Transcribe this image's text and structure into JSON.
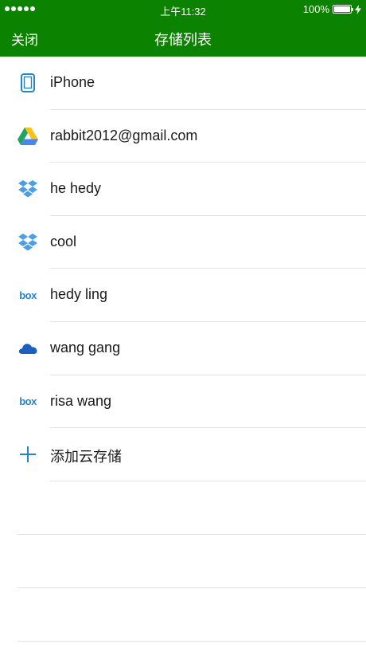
{
  "status_bar": {
    "time": "上午11:32",
    "battery_percent_label": "100%",
    "battery_level": 1.0,
    "signal_dots": 5
  },
  "nav": {
    "close_label": "关闭",
    "title": "存储列表"
  },
  "colors": {
    "header_bg": "#0b8300",
    "accent_blue": "#2486c9",
    "divider": "#e3e3e3"
  },
  "storage_list": [
    {
      "label": "iPhone",
      "icon": "iphone-device-icon"
    },
    {
      "label": "rabbit2012@gmail.com",
      "icon": "google-drive-icon"
    },
    {
      "label": "he hedy",
      "icon": "dropbox-icon"
    },
    {
      "label": "cool",
      "icon": "dropbox-icon"
    },
    {
      "label": "hedy ling",
      "icon": "box-icon"
    },
    {
      "label": "wang gang",
      "icon": "onedrive-icon"
    },
    {
      "label": "risa wang",
      "icon": "box-icon"
    },
    {
      "label": "添加云存储",
      "icon": "plus-icon"
    }
  ],
  "icons": {
    "box_text": "box"
  }
}
